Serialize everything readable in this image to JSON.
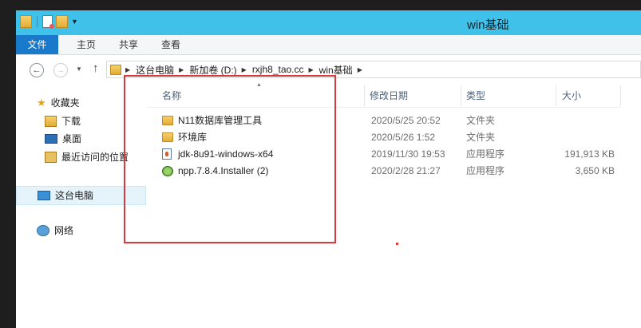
{
  "window": {
    "title": "win基础"
  },
  "ribbon": {
    "tabs": [
      "文件",
      "主页",
      "共享",
      "查看"
    ]
  },
  "address": {
    "crumbs": [
      "这台电脑",
      "新加卷 (D:)",
      "rxjh8_tao.cc",
      "win基础"
    ]
  },
  "nav": {
    "favorites": "收藏夹",
    "downloads": "下载",
    "desktop": "桌面",
    "recent": "最近访问的位置",
    "this_pc": "这台电脑",
    "network": "网络"
  },
  "columns": {
    "name": "名称",
    "date": "修改日期",
    "type": "类型",
    "size": "大小"
  },
  "files": [
    {
      "name": "N11数据库管理工具",
      "date": "2020/5/25 20:52",
      "type": "文件夹",
      "size": "",
      "icon": "folder-icon"
    },
    {
      "name": "环境库",
      "date": "2020/5/26 1:52",
      "type": "文件夹",
      "size": "",
      "icon": "folder-icon"
    },
    {
      "name": "jdk-8u91-windows-x64",
      "date": "2019/11/30 19:53",
      "type": "应用程序",
      "size": "191,913 KB",
      "icon": "java-installer-icon"
    },
    {
      "name": "npp.7.8.4.Installer (2)",
      "date": "2020/2/28 21:27",
      "type": "应用程序",
      "size": "3,650 KB",
      "icon": "notepadpp-icon"
    }
  ],
  "colors": {
    "titlebar": "#3fc1ea",
    "file_tab": "#1979ca",
    "highlight": "#d9393e"
  }
}
